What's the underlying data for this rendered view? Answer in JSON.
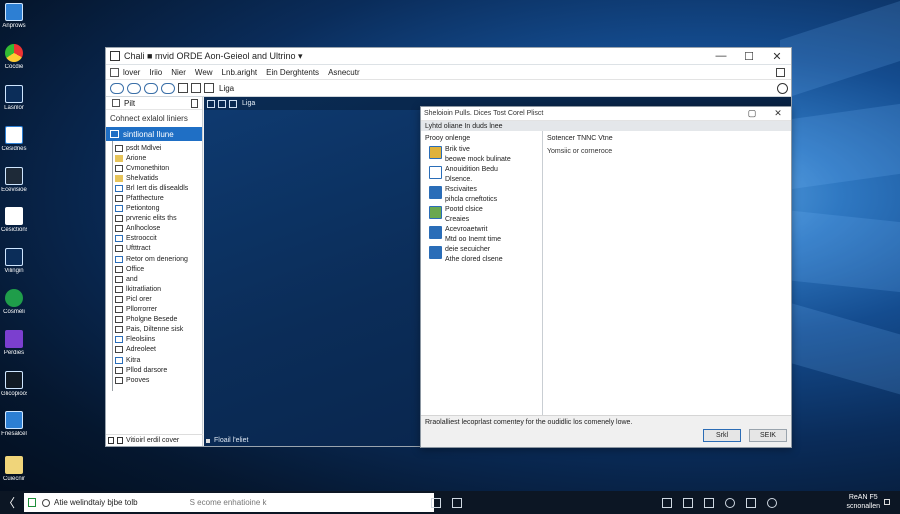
{
  "desktop": {
    "icons": [
      {
        "label": "Anprows",
        "icon": "app-blue-icon"
      },
      {
        "label": "Cocdie",
        "icon": "chrome-icon"
      },
      {
        "label": "Lasnlor",
        "icon": "phone-icon"
      },
      {
        "label": "Cesidnes",
        "icon": "network-icon"
      },
      {
        "label": "Ecevisioe",
        "icon": "monitor-icon"
      },
      {
        "label": "Cesictions",
        "icon": "document-icon"
      },
      {
        "label": "Vilingin",
        "icon": "device-icon"
      },
      {
        "label": "Cosmeli",
        "icon": "green-app-icon"
      },
      {
        "label": "Perdies",
        "icon": "purple-app-icon"
      },
      {
        "label": "Glicopioos",
        "icon": "screen-icon"
      },
      {
        "label": "Fnesalcel",
        "icon": "blue-app-icon"
      },
      {
        "label": "Cuiecnir",
        "icon": "folder-icon"
      }
    ]
  },
  "window": {
    "title": "Chali  ■ mvid ORDE Aon-Geieol and Ultrino ▾",
    "controls": {
      "minimize": "—",
      "maximize": "☐",
      "close": "✕"
    },
    "menu": [
      "lover",
      "Iriio",
      "Nier",
      "Wew",
      "Lnb.aright",
      "Ein Derghtents",
      "Asnecutr"
    ],
    "toolbar_label": "Liga",
    "nav": {
      "top_label": "Pilt",
      "section": "Cohnect exlalol liniers",
      "selected": "sintlional Ilune",
      "items": [
        "psdt Mdlvei",
        "Arione",
        "Cvmonethiton",
        "Shelvatids",
        "Brl Iert dis dlisealdls",
        "Pfatthecture",
        "Petiontong",
        "prvrenic elits ths",
        "Anlhoclose",
        "Estrooccit",
        "Uftttract",
        "Retor om deneriong",
        "Office",
        "and",
        "lkitratliation",
        "Picl orer",
        "Pllorrorrer",
        "Pholgne Besede",
        "Pais, Diltenne sisk",
        "Fleolsiins",
        "Adreoleet",
        "Kitra",
        "Pllod darsore",
        "Pooves"
      ],
      "bottom": "Vitioirl erdil cover"
    },
    "pane_footer": "Floail l'eliet"
  },
  "dialog": {
    "title": "Sheloioin Pulls. Dices Tost Corel Plisct",
    "subtitle": "Lyhtd oliane In duds lnee",
    "left_heading": "Prooy onlenge",
    "items": [
      {
        "label": "Brik tive\nbeowe mock bulinate",
        "color": "#e0b23a"
      },
      {
        "label": "Anouidition Bedu\nDlsence.",
        "color": "#ffffff"
      },
      {
        "label": "Rscivaites\npihcla crneftotics",
        "color": "#2a6db8"
      },
      {
        "label": "Pootd clsice\nCreaies",
        "color": "#6aa84f"
      },
      {
        "label": "Acevroaetwrit\nMtd oo Inemt time",
        "color": "#2a6db8"
      },
      {
        "label": "deie secuicher\nAthe clored clsene",
        "color": "#2a6db8"
      }
    ],
    "right_heading": "Sotencer TNNC Vtne",
    "right_text": "Yomsiic or corneroce",
    "footer_text": "Rraolalliest lecoprlast comentey for the oudidlic los comenely lowe.",
    "ok_label": "Srkl",
    "cancel_label": "SEIK"
  },
  "taskbar": {
    "start": "〈",
    "search_text": "Atie welindtaiy bjbe tolb",
    "search_placeholder": "S ecome enhatioine k",
    "clock_time": "ReAN F5",
    "clock_date": "scnonallen"
  }
}
